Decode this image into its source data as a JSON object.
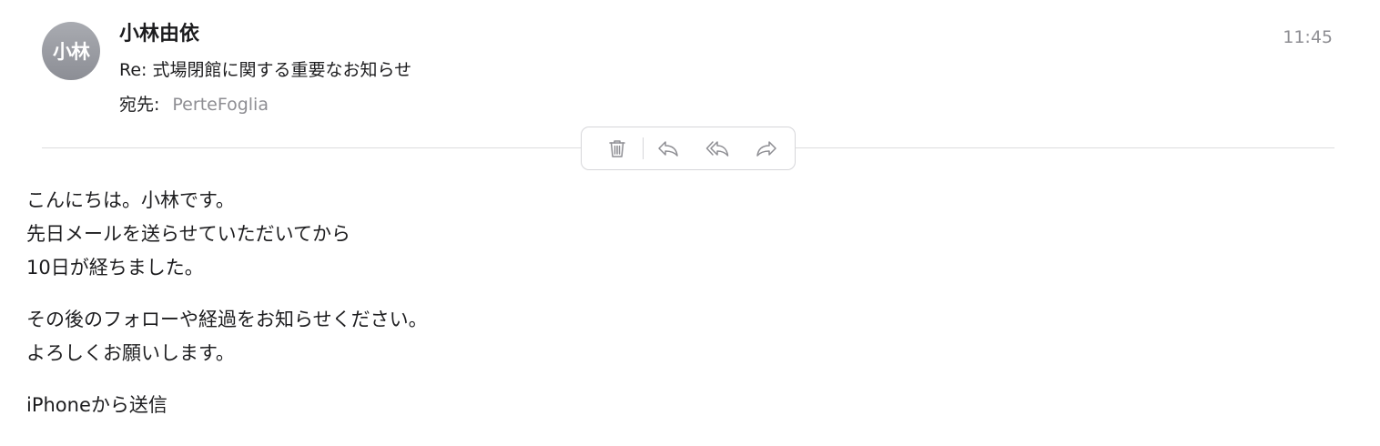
{
  "message": {
    "avatar_initials": "小林",
    "sender": "小林由依",
    "subject": "Re: 式場閉館に関する重要なお知らせ",
    "recipient_label": "宛先:",
    "recipient": "PerteFoglia",
    "time": "11:45"
  },
  "toolbar": {
    "delete_icon": "trash-icon",
    "reply_icon": "reply-icon",
    "reply_all_icon": "reply-all-icon",
    "forward_icon": "forward-icon"
  },
  "body": {
    "paragraph1": [
      "こんにちは。小林です。",
      "先日メールを送らせていただいてから",
      "10日が経ちました。"
    ],
    "paragraph2": [
      "その後のフォローや経過をお知らせください。",
      "よろしくお願いします。"
    ],
    "signature": "iPhoneから送信"
  },
  "colors": {
    "icon": "#8e8e93",
    "secondary_text": "#8e8e93",
    "divider": "#dcdcde"
  }
}
